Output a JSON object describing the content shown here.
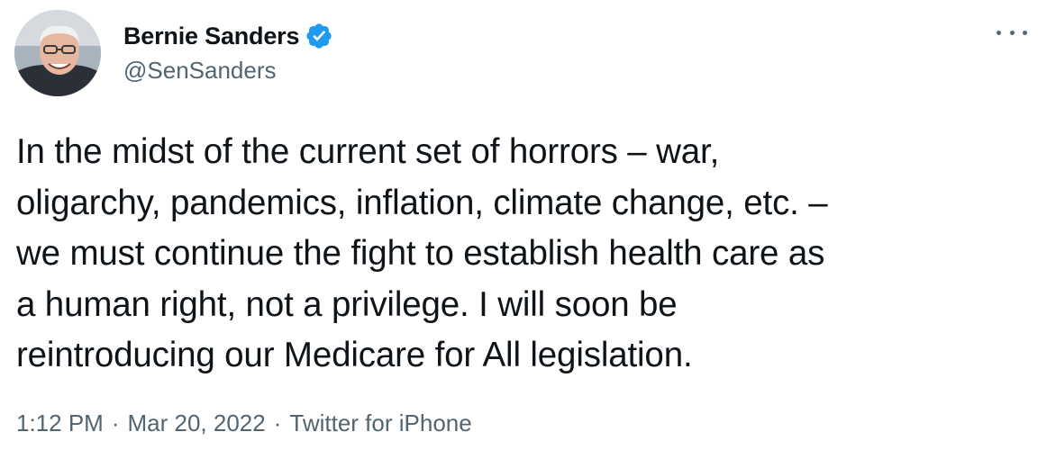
{
  "author": {
    "display_name": "Bernie Sanders",
    "handle": "@SenSanders",
    "verified": true,
    "avatar_icon": "profile-photo"
  },
  "tweet": {
    "text": "In the midst of the current set of horrors – war,\noligarchy, pandemics, inflation, climate change, etc. –\nwe must continue the fight to establish health care as\na human right, not a privilege. I will soon be\nreintroducing our Medicare for All legislation."
  },
  "meta": {
    "time": "1:12 PM",
    "separator": "·",
    "date": "Mar 20, 2022",
    "source": "Twitter for iPhone"
  },
  "colors": {
    "text": "#0f1419",
    "secondary": "#536471",
    "verified_badge": "#1d9bf0"
  },
  "menu_icon": "more-icon"
}
